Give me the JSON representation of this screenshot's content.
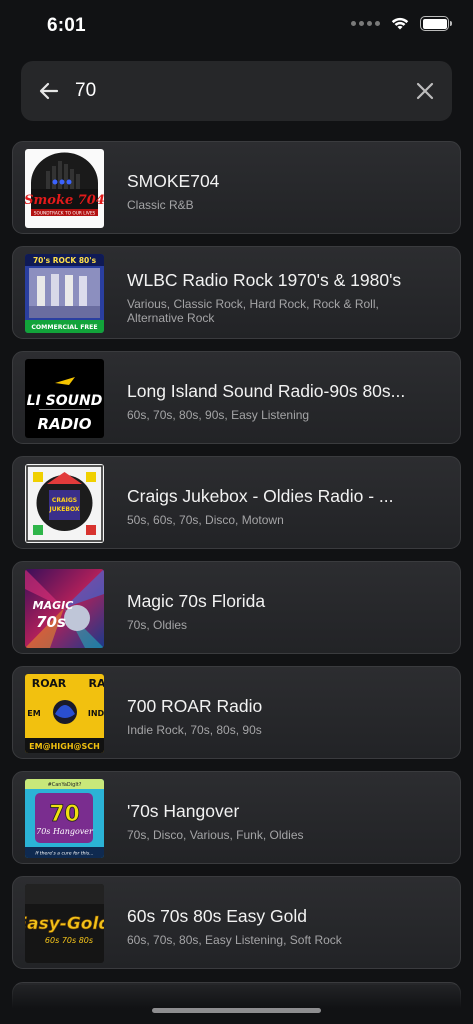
{
  "status": {
    "time": "6:01"
  },
  "search": {
    "query": "70"
  },
  "results": [
    {
      "title": "SMOKE704",
      "genres": "Classic R&B",
      "logo_text": "Smoke 704",
      "logo_subtext": "SOUNDTRACK TO OUR LIVES"
    },
    {
      "title": "WLBC Radio Rock 1970's & 1980's",
      "genres": "Various, Classic Rock, Hard Rock, Rock & Roll, Alternative Rock",
      "logo_text": "70's ROCK 80's",
      "logo_subtext": "COMMERCIAL FREE"
    },
    {
      "title": "Long Island Sound Radio-90s 80s...",
      "genres": "60s, 70s, 80s, 90s, Easy Listening",
      "logo_text": "LI SOUND",
      "logo_subtext": "RADIO"
    },
    {
      "title": "Craigs Jukebox - Oldies Radio - ...",
      "genres": "50s, 60s, 70s, Disco, Motown",
      "logo_text": "CRAIGS JUKEBOX",
      "logo_subtext": ""
    },
    {
      "title": "Magic 70s Florida",
      "genres": "70s, Oldies",
      "logo_text": "MAGIC 70S",
      "logo_subtext": ""
    },
    {
      "title": "700 ROAR Radio",
      "genres": "Indie Rock, 70s, 80s, 90s",
      "logo_text": "ROAR",
      "logo_subtext": "EM@HIGH@SCH"
    },
    {
      "title": "'70s Hangover",
      "genres": "70s, Disco, Various, Funk, Oldies",
      "logo_text": "70s Hangover",
      "logo_subtext": "If there's a cure for this..."
    },
    {
      "title": " 60s 70s 80s Easy Gold",
      "genres": "60s, 70s, 80s, Easy Listening, Soft Rock",
      "logo_text": "Easy-Gold",
      "logo_subtext": "60s 70s 80s"
    }
  ]
}
